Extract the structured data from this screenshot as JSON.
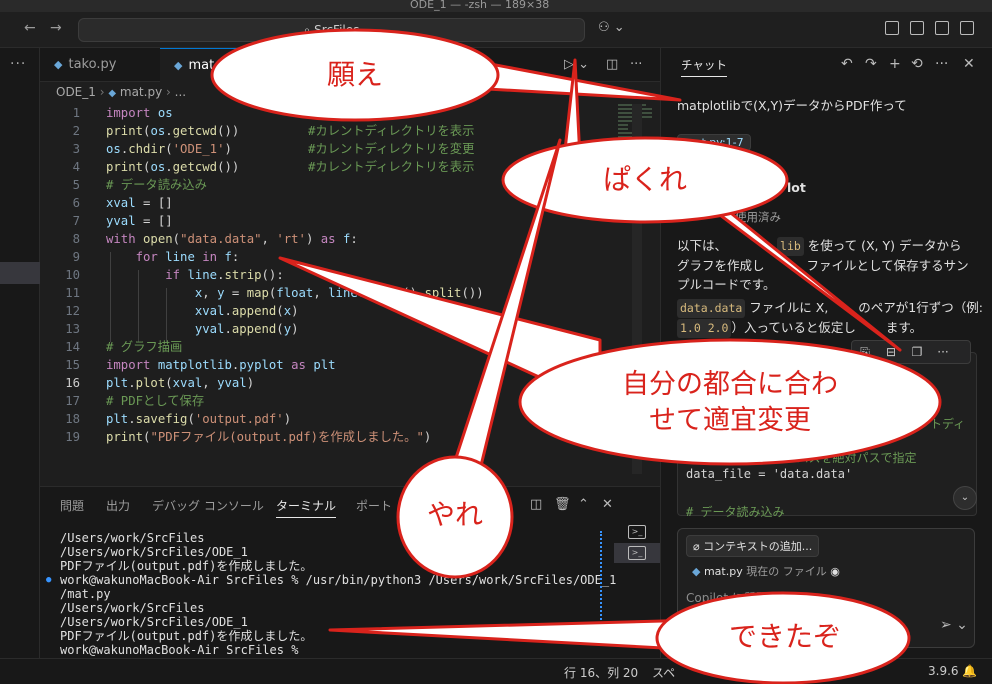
{
  "window": {
    "title": "ODE_1 — -zsh — 189×38"
  },
  "topbar": {
    "search_text": "SrcFiles",
    "back_icon": "arrow-left-icon",
    "forward_icon": "arrow-right-icon"
  },
  "tabs": [
    {
      "label": "tako.py",
      "active": false
    },
    {
      "label": "mat",
      "active": true
    }
  ],
  "breadcrumb": {
    "folder": "ODE_1",
    "file": "mat.py",
    "more": "..."
  },
  "editor": {
    "current_line": 16,
    "lines": [
      {
        "n": "1",
        "code": "import os"
      },
      {
        "n": "2",
        "code": "print(os.getcwd())",
        "comment": "#カレントディレクトリを表示"
      },
      {
        "n": "3",
        "code": "os.chdir('ODE_1')",
        "comment": "#カレントディレクトリを変更"
      },
      {
        "n": "4",
        "code": "print(os.getcwd())",
        "comment": "#カレントディレクトリを表示"
      },
      {
        "n": "5",
        "code": "# データ読み込み"
      },
      {
        "n": "6",
        "code": "xval = []"
      },
      {
        "n": "7",
        "code": "yval = []"
      },
      {
        "n": "8",
        "code": "with open(\"data.data\", 'rt') as f:"
      },
      {
        "n": "9",
        "code": "    for line in f:"
      },
      {
        "n": "10",
        "code": "        if line.strip():"
      },
      {
        "n": "11",
        "code": "            x, y = map(float, line.strip().split())"
      },
      {
        "n": "12",
        "code": "            xval.append(x)"
      },
      {
        "n": "13",
        "code": "            yval.append(y)"
      },
      {
        "n": "14",
        "code": "# グラフ描画"
      },
      {
        "n": "15",
        "code": "import matplotlib.pyplot as plt"
      },
      {
        "n": "16",
        "code": "plt.plot(xval, yval)"
      },
      {
        "n": "17",
        "code": "# PDFとして保存"
      },
      {
        "n": "18",
        "code": "plt.savefig('output.pdf')"
      },
      {
        "n": "19",
        "code": "print(\"PDFファイル(output.pdf)を作成しました。\")"
      }
    ]
  },
  "panel": {
    "tabs": [
      "問題",
      "出力",
      "デバッグ コンソール",
      "ターミナル",
      "ポート"
    ],
    "active_tab": "ターミナル",
    "terminal_lines": [
      "/Users/work/SrcFiles",
      "/Users/work/SrcFiles/ODE_1",
      "PDFファイル(output.pdf)を作成しました。",
      "work@wakunoMacBook-Air SrcFiles % /usr/bin/python3 /Users/work/SrcFiles/ODE_1",
      "/mat.py",
      "/Users/work/SrcFiles",
      "/Users/work/SrcFiles/ODE_1",
      "PDFファイル(output.pdf)を作成しました。",
      "work@wakunoMacBook-Air SrcFiles % "
    ]
  },
  "chat": {
    "header": "チャット",
    "user_message": "matplotlibで(X,Y)データからPDF作って",
    "file_ref": "mat.py:1-7",
    "assistant_name": "lot",
    "used_note": "使用済み",
    "para1": "以下は、",
    "para1_chip": "lib",
    "para1_rest": " を使って (X, Y) データから",
    "para2": "グラフを作成し",
    "para2_rest": "ファイルとして保存するサン",
    "para3": "プルコードです。",
    "para4_chip": "data.data",
    "para4_rest": " ファイルに X,",
    "para4_rest2": "のペアが1行ずつ（例:",
    "para5_chip": "1.0 2.0",
    "para5_rest": "）入っていると仮定し",
    "para5_end": "ます。",
    "code_lines": [
      {
        "text": "ントディ",
        "cls": "cm"
      },
      {
        "text": "# データファイルのパスを絶対パスで指定",
        "cls": "cm"
      },
      {
        "text": "data_file = 'data.data'",
        "cls": "pl"
      },
      {
        "text": "",
        "cls": "pl"
      },
      {
        "text": "# データ読み込み",
        "cls": "cm"
      }
    ],
    "add_context": "コンテキストの追加...",
    "current_file": "mat.py",
    "current_file_note": "現在の ファイル",
    "input_placeholder": "Copilot に質問"
  },
  "status": {
    "position": "行 16、列 20",
    "spaces": "スペ",
    "python_version": "3.9.6"
  },
  "annotations": [
    {
      "text": "願え"
    },
    {
      "text": "ぱくれ"
    },
    {
      "text": "自分の都合に合わ"
    },
    {
      "text": "せて適宜変更"
    },
    {
      "text": "やれ"
    },
    {
      "text": "できたぞ"
    }
  ],
  "colors": {
    "annotation_red": "#d9231c",
    "accent_blue": "#0078d4"
  }
}
